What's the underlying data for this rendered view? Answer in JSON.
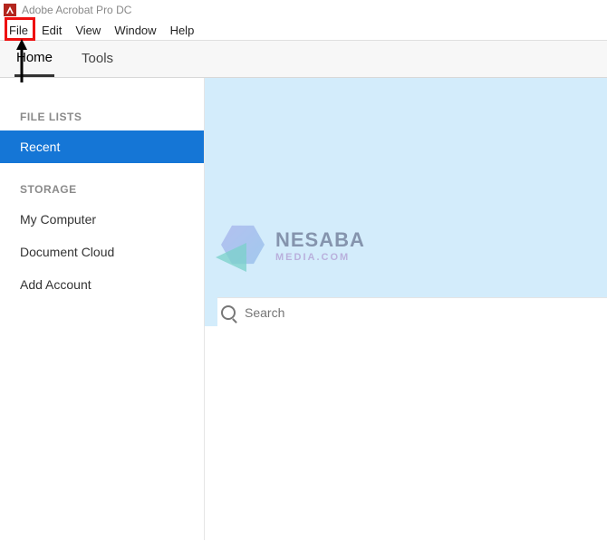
{
  "titlebar": {
    "app_name": "Adobe Acrobat Pro DC"
  },
  "menubar": {
    "file": "File",
    "edit": "Edit",
    "view": "View",
    "window": "Window",
    "help": "Help"
  },
  "toolbar": {
    "home": "Home",
    "tools": "Tools"
  },
  "sidebar": {
    "file_lists_label": "FILE LISTS",
    "recent": "Recent",
    "storage_label": "STORAGE",
    "my_computer": "My Computer",
    "document_cloud": "Document Cloud",
    "add_account": "Add Account"
  },
  "content": {
    "search_placeholder": "Search"
  },
  "watermark": {
    "text_main": "NESABA",
    "text_sub": "MEDIA.COM"
  }
}
